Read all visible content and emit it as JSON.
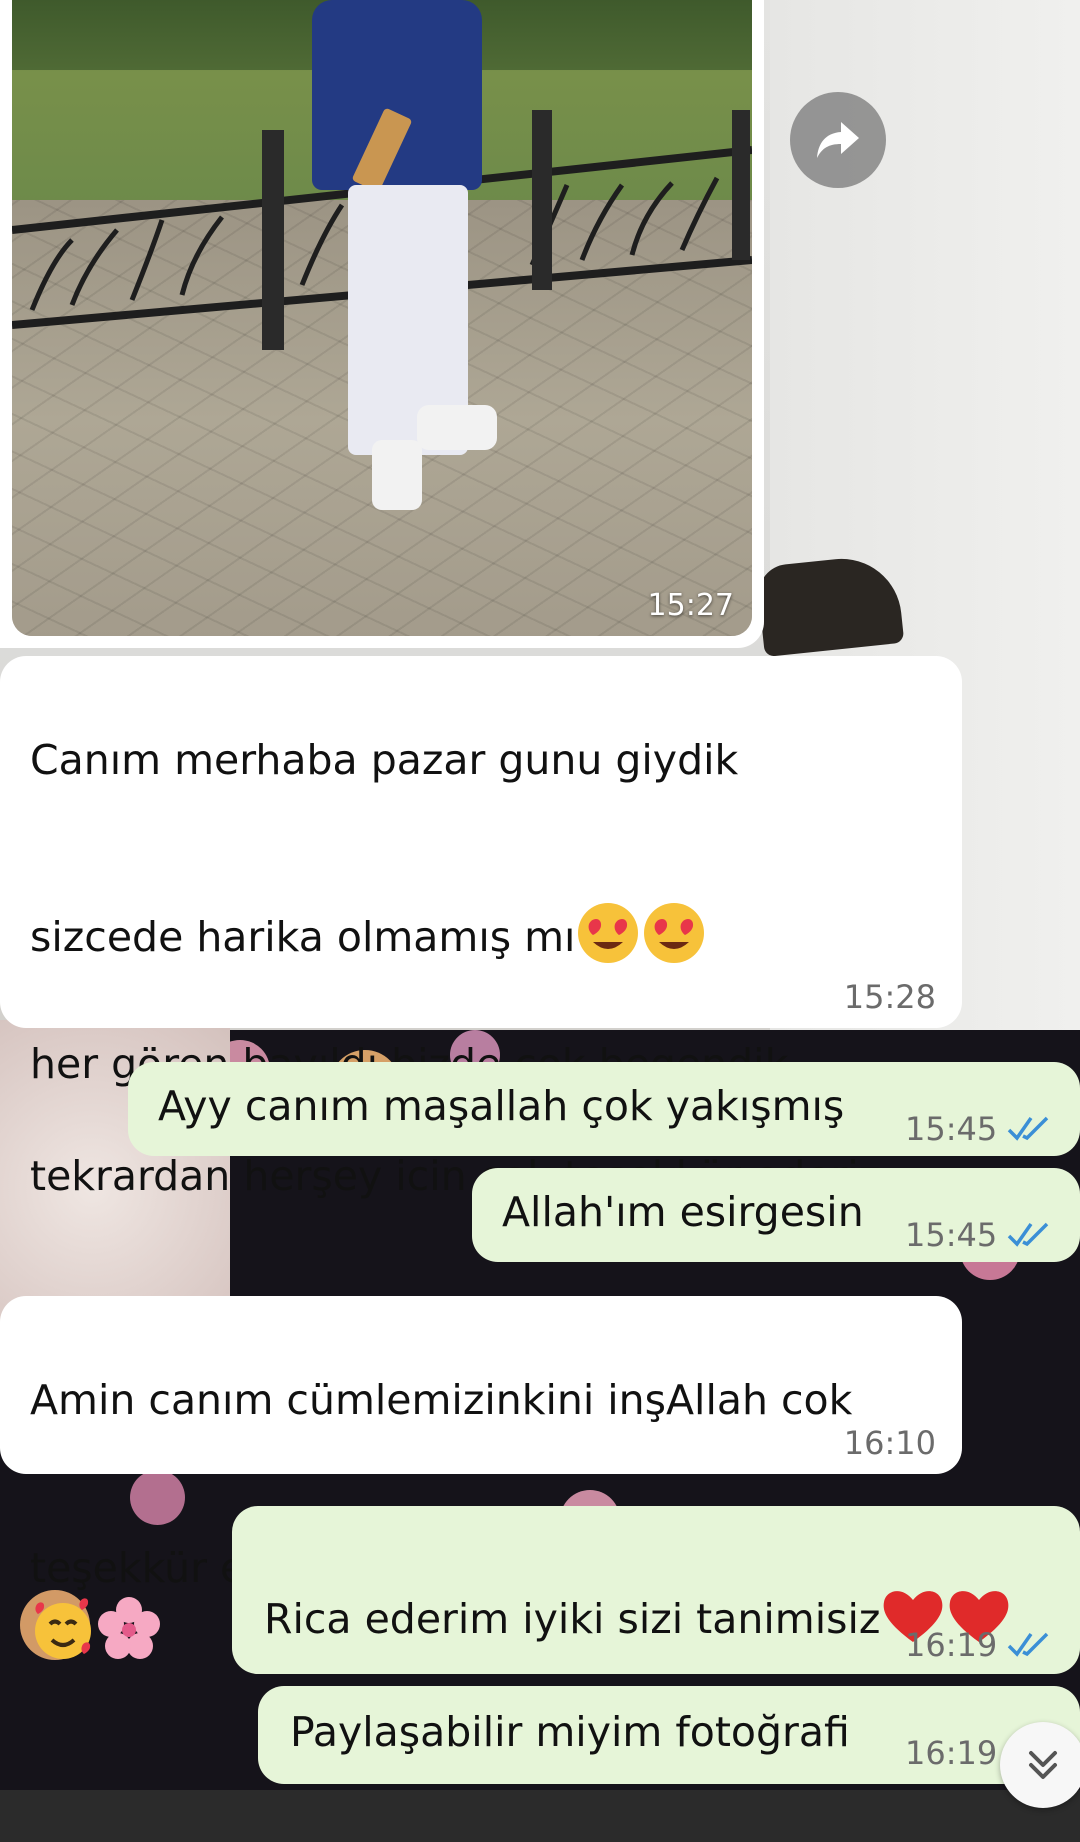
{
  "photo_message": {
    "time": "15:27"
  },
  "messages": [
    {
      "id": "m1",
      "direction": "in",
      "lines": [
        "Canım merhaba pazar gunu giydik",
        "sizcede harika olmamış mı",
        "her gören bayıldı bizde çok begendik",
        "tekrardan herşey icin çok teşekkür ederiz"
      ],
      "emojis": [
        "heart-eyes-emoji",
        "heart-eyes-emoji",
        "melting-face-emoji"
      ],
      "time": "15:28"
    },
    {
      "id": "m2",
      "direction": "out",
      "text": "Ayy canım maşallah çok yakışmış",
      "time": "15:45",
      "status": "read"
    },
    {
      "id": "m3",
      "direction": "out",
      "text": "Allah'ım esirgesin",
      "time": "15:45",
      "status": "read"
    },
    {
      "id": "m4",
      "direction": "in",
      "lines": [
        "Amin canım cümlemizinkini inşAllah cok",
        "teşekkür ederiz"
      ],
      "emojis": [
        "smiling-hearts-emoji",
        "cherry-blossom-emoji"
      ],
      "time": "16:10"
    },
    {
      "id": "m5",
      "direction": "out",
      "text": "Rica ederim iyiki sizi tanimisiz",
      "emojis": [
        "red-heart-emoji",
        "red-heart-emoji"
      ],
      "time": "16:19",
      "status": "read"
    },
    {
      "id": "m6",
      "direction": "out",
      "text": "Paylaşabilir miyim fotoğrafi",
      "time": "16:19"
    }
  ],
  "icons": {
    "share": "forward-arrow-icon",
    "scroll": "double-chevron-down-icon",
    "read_receipt": "double-check-icon"
  },
  "colors": {
    "outgoing_bubble": "#e6f5d8",
    "incoming_bubble": "#ffffff",
    "read_tick": "#3b8fd6"
  }
}
